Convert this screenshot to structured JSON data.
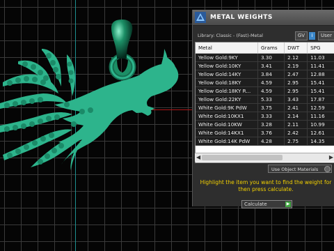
{
  "colors": {
    "accent": "#f2d000",
    "model": "#2db48c",
    "panel_bg": "#2e2e2e",
    "info_blue": "#3b87c9",
    "calc_green": "#43a843"
  },
  "icons": {
    "logo": "jewelry-app-icon",
    "info": "info-icon",
    "go": "play-arrow-icon",
    "scroll_left": "left-arrow-icon",
    "scroll_right": "right-arrow-icon"
  },
  "panel": {
    "title": "METAL WEIGHTS",
    "library_label": "Library: Classic - (Fast)-Metal",
    "gv_button": "GV",
    "info_button": "i",
    "user_button": "User",
    "materials_dropdown": "Use Object Materials",
    "instruction": "Highlight the item you want to find the weight for then press calculate.",
    "calc_select": "Calculate"
  },
  "table": {
    "headers": [
      "Metal",
      "Grams",
      "DWT",
      "SPG"
    ],
    "rows": [
      [
        "Yellow Gold:9KY",
        "3.30",
        "2.12",
        "11.03"
      ],
      [
        "Yellow Gold:10KY",
        "3.41",
        "2.19",
        "11.41"
      ],
      [
        "Yellow Gold:14KY",
        "3.84",
        "2.47",
        "12.88"
      ],
      [
        "Yellow Gold:18KY",
        "4.59",
        "2.95",
        "15.41"
      ],
      [
        "Yellow Gold:18KY R...",
        "4.59",
        "2.95",
        "15.41"
      ],
      [
        "Yellow Gold:22KY",
        "5.33",
        "3.43",
        "17.87"
      ],
      [
        "White Gold:9K PdW",
        "3.75",
        "2.41",
        "12.59"
      ],
      [
        "White Gold:10KX1",
        "3.33",
        "2.14",
        "11.16"
      ],
      [
        "White Gold:10KW",
        "3.28",
        "2.11",
        "10.99"
      ],
      [
        "White Gold:14KX1",
        "3.76",
        "2.42",
        "12.61"
      ],
      [
        "White Gold:14K PdW",
        "4.28",
        "2.75",
        "14.35"
      ]
    ]
  }
}
